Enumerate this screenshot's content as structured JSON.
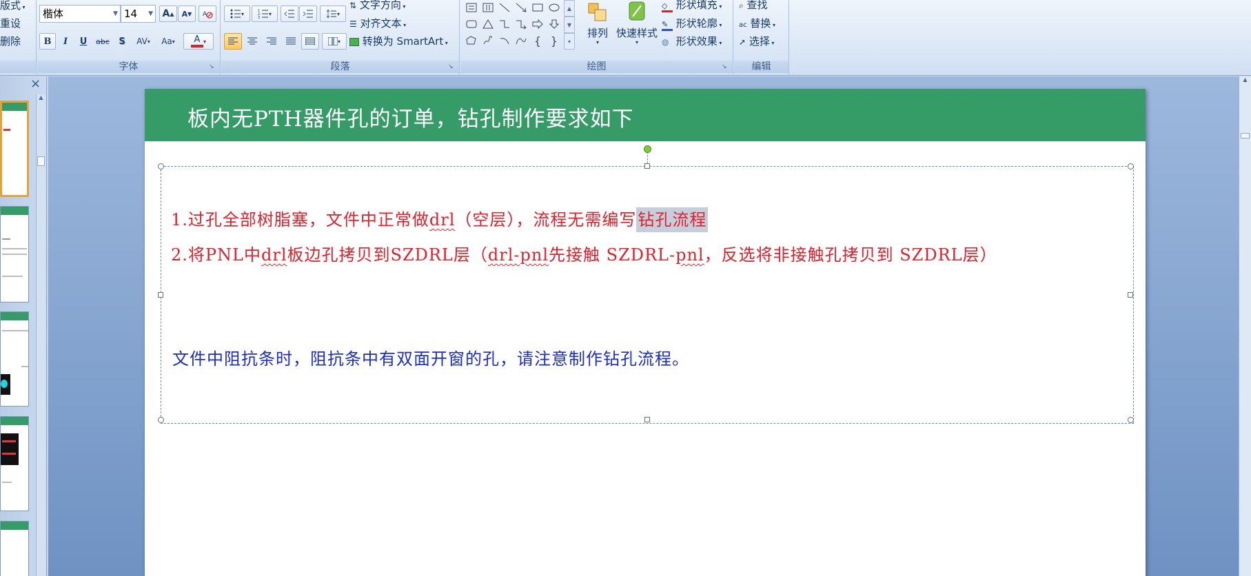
{
  "ribbon": {
    "slides_group": {
      "layout_label": "版式",
      "reset_label": "重设",
      "delete_label": "删除"
    },
    "font_group": {
      "font_name": "楷体",
      "font_size": "14",
      "grow_label": "A",
      "shrink_label": "A",
      "bold": "B",
      "italic": "I",
      "underline": "U",
      "strike": "abc",
      "shadow": "S",
      "spacing": "AV",
      "case": "Aa",
      "color_letter": "A",
      "label": "字体",
      "font_color": "#e0202a"
    },
    "paragraph_group": {
      "text_direction_label": "文字方向",
      "align_text_label": "对齐文本",
      "smartart_label": "转换为 SmartArt",
      "label": "段落"
    },
    "drawing_group": {
      "arrange_label": "排列",
      "quick_styles_label": "快速样式",
      "shape_fill_label": "形状填充",
      "shape_outline_label": "形状轮廓",
      "shape_effects_label": "形状效果",
      "label": "绘图"
    },
    "editing_group": {
      "find_label": "查找",
      "replace_label": "替换",
      "select_label": "选择",
      "label": "编辑"
    }
  },
  "slide": {
    "title": "板内无PTH器件孔的订单，钻孔制作要求如下",
    "header_color": "#359b67",
    "line1": {
      "prefix": "1.过孔全部树脂塞，文件中正常做",
      "drl": "drl",
      "middle": "（空层），流程无需编写",
      "selected": "钻孔流程"
    },
    "line2": {
      "prefix": "2.将PNL中",
      "drl": "drl",
      "part2": "板边孔拷贝到SZDRL层（",
      "drlpnl": "drl-pnl",
      "part3": "先接触 SZDRL-",
      "pnl": "pnl",
      "part4": "，反选将非接触孔拷贝到 SZDRL层）"
    },
    "note": "文件中阻抗条时，阻抗条中有双面开窗的孔，请注意制作钻孔流程。"
  },
  "thumbs": {
    "close_icon": "×"
  }
}
